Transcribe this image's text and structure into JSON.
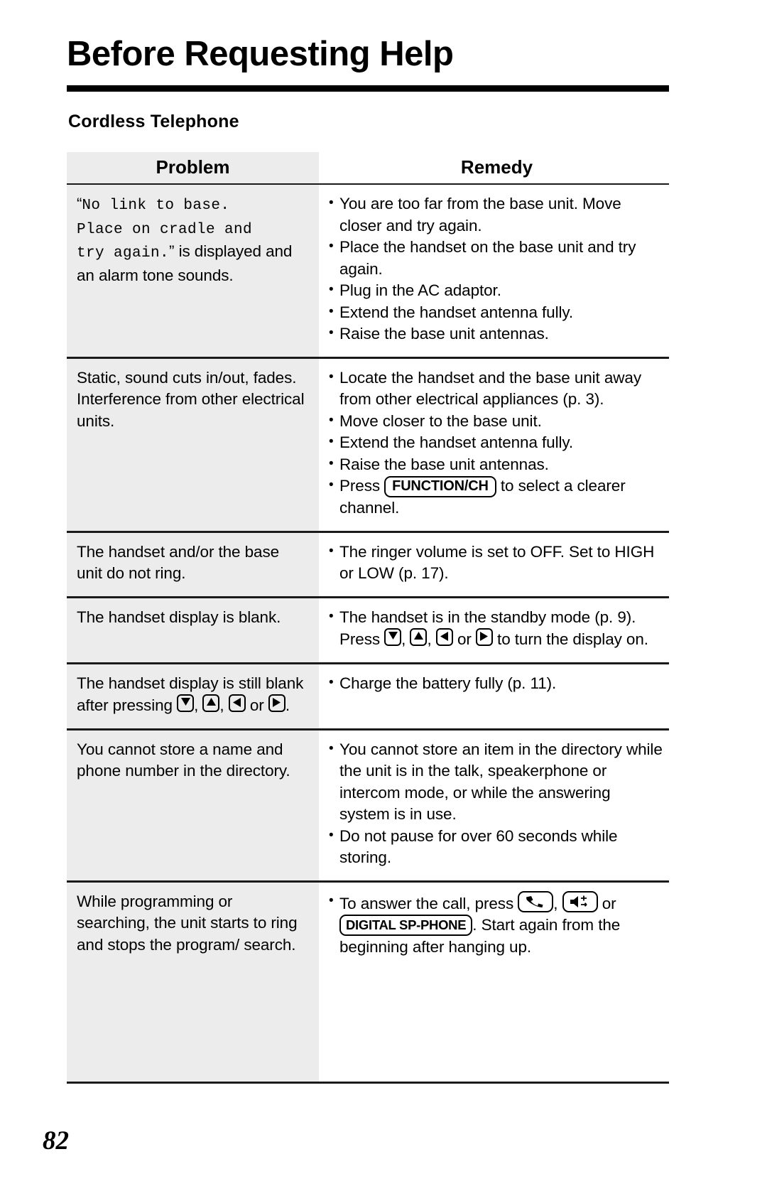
{
  "document": {
    "title": "Before Requesting Help",
    "section_title": "Cordless Telephone",
    "page_number": "82"
  },
  "table": {
    "headers": {
      "problem": "Problem",
      "remedy": "Remedy"
    },
    "rows": [
      {
        "problem_quote_open": "“",
        "problem_mono": "No link to base. Place on cradle and try again.",
        "problem_mono_line1": "No link to base.",
        "problem_mono_line2": "Place on cradle and",
        "problem_mono_line3": "try again.",
        "problem_quote_close": "”",
        "problem_tail": " is displayed and an alarm tone sounds.",
        "remedies": [
          "You are too far from the base unit. Move closer and try again.",
          "Place the handset on the base unit and try again.",
          "Plug in the AC adaptor.",
          "Extend the handset antenna fully.",
          "Raise the base unit antennas."
        ]
      },
      {
        "problem": "Static, sound cuts in/out, fades. Interference from other electrical units.",
        "remedies": [
          "Locate the handset and the base unit away from other electrical appliances (p. 3).",
          "Move closer to the base unit.",
          "Extend the handset antenna fully.",
          "Raise the base unit antennas."
        ],
        "remedy_with_key": {
          "before": "Press ",
          "key_label": "FUNCTION/CH",
          "after": " to select a clearer channel."
        }
      },
      {
        "problem": "The handset and/or the base unit do not ring.",
        "remedies": [
          "The ringer volume is set to OFF. Set to HIGH or LOW (p. 17)."
        ]
      },
      {
        "problem": "The handset display is blank.",
        "remedy_arrows": {
          "before": "The handset is in the standby mode (p. 9). Press ",
          "sep1": ", ",
          "sep2": ", ",
          "sep3": " or ",
          "after": " to turn the display on.",
          "keys": [
            "down-arrow",
            "up-arrow",
            "left-arrow",
            "right-arrow"
          ]
        }
      },
      {
        "problem_arrows": {
          "before": "The handset display is still blank after pressing ",
          "sep1": ", ",
          "sep2": ", ",
          "sep3": " or ",
          "after": ".",
          "keys": [
            "down-arrow",
            "up-arrow",
            "left-arrow",
            "right-arrow"
          ]
        },
        "remedies": [
          "Charge the battery fully (p. 11)."
        ]
      },
      {
        "problem": "You cannot store a name and phone number in the directory.",
        "remedies": [
          "You cannot store an item in the directory while the unit is in the talk, speakerphone or intercom mode, or while the answering system is in use.",
          "Do not pause for over 60 seconds while storing."
        ]
      },
      {
        "problem": "While programming or searching, the unit starts to ring and stops the program/ search.",
        "remedy_keys": {
          "before": "To answer the call, press ",
          "sep1": ", ",
          "sep2": " or ",
          "key_label": "DIGITAL SP-PHONE",
          "after": ". Start again from the beginning after hanging up.",
          "icons": [
            "talk-handset-icon",
            "speakerphone-icon"
          ]
        }
      }
    ]
  }
}
